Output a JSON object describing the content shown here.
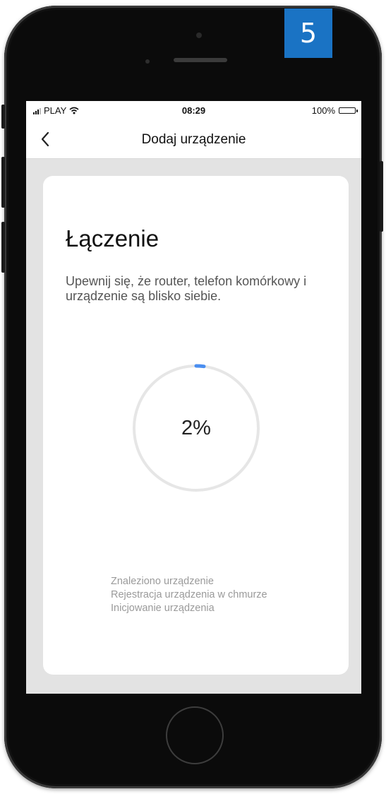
{
  "step_badge": "5",
  "status_bar": {
    "carrier": "PLAY",
    "time": "08:29",
    "battery": "100%"
  },
  "nav": {
    "title": "Dodaj urządzenie",
    "back_icon": "chevron-left-icon"
  },
  "card": {
    "title": "Łączenie",
    "description": "Upewnij się, że router, telefon komórkowy i urządzenie są blisko siebie.",
    "progress_value": 0.02,
    "progress_label": "2%",
    "steps": [
      "Znaleziono urządzenie",
      "Rejestracja urządzenia w chmurze",
      "Inicjowanie urządzenia"
    ]
  },
  "colors": {
    "accent": "#4a8ef0",
    "badge": "#1a73c4",
    "ring_track": "#e6e6e6"
  }
}
